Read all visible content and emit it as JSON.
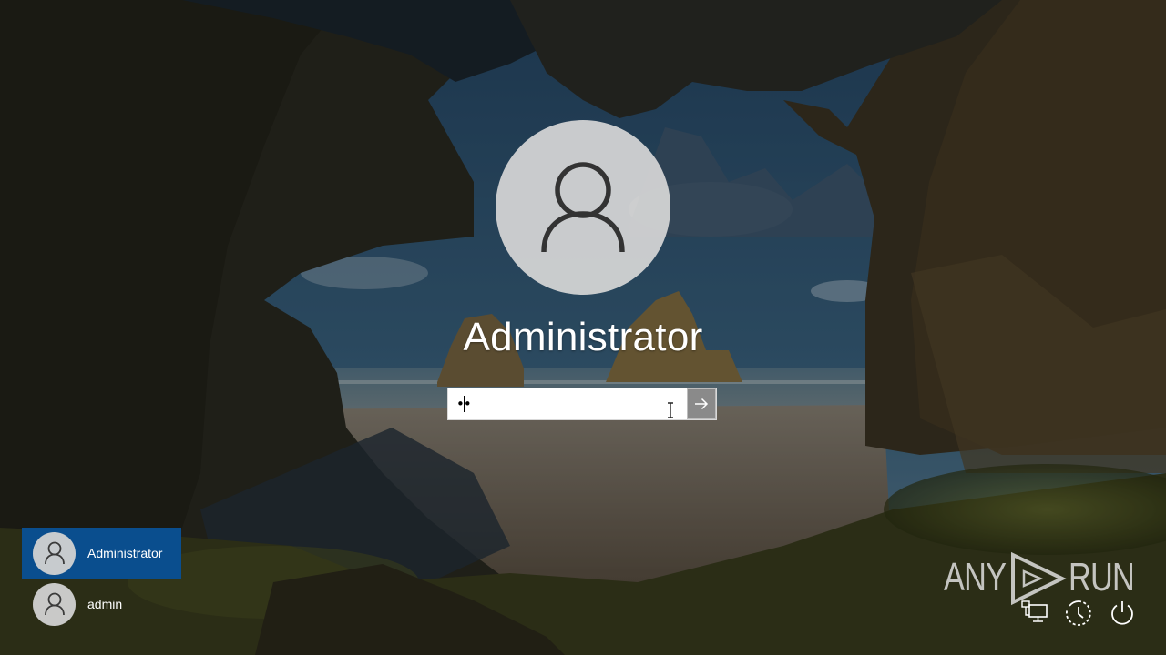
{
  "login": {
    "username": "Administrator",
    "password_value": "••",
    "submit_label": "→"
  },
  "users": [
    {
      "name": "Administrator",
      "selected": true
    },
    {
      "name": "admin",
      "selected": false
    }
  ],
  "watermark": {
    "left": "ANY",
    "right": "RUN"
  },
  "icons": {
    "user": "user-icon",
    "submit": "arrow-right-icon",
    "network": "network-icon",
    "accessibility": "ease-of-access-icon",
    "power": "power-icon"
  },
  "colors": {
    "selected_user_bg": "#0a4e8e",
    "avatar_bg": "#d6d6d6"
  }
}
